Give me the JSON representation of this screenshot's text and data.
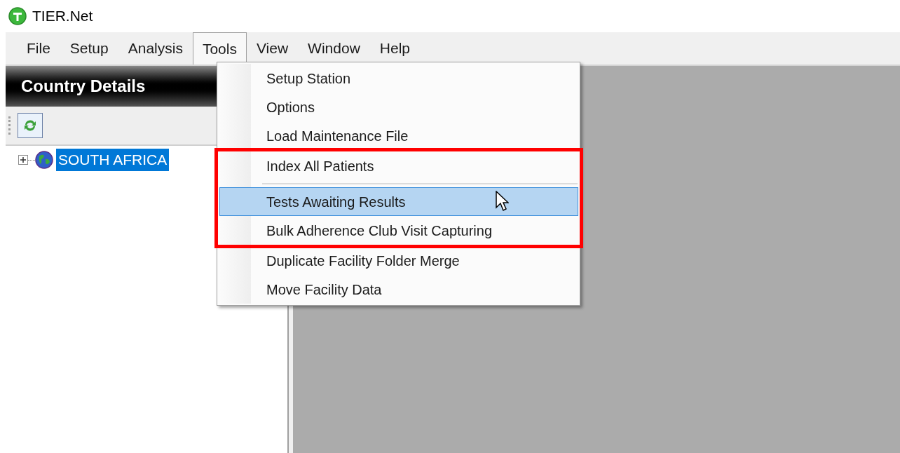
{
  "window": {
    "title": "TIER.Net"
  },
  "menu_bar": [
    {
      "label": "File",
      "open": false
    },
    {
      "label": "Setup",
      "open": false
    },
    {
      "label": "Analysis",
      "open": false
    },
    {
      "label": "Tools",
      "open": true
    },
    {
      "label": "View",
      "open": false
    },
    {
      "label": "Window",
      "open": false
    },
    {
      "label": "Help",
      "open": false
    }
  ],
  "dropdown": {
    "items": [
      {
        "kind": "item",
        "label": "Setup Station",
        "selected": false
      },
      {
        "kind": "item",
        "label": "Options",
        "selected": false
      },
      {
        "kind": "item",
        "label": "Load Maintenance File",
        "selected": false
      },
      {
        "kind": "item",
        "label": "Index All Patients",
        "selected": false,
        "annotated": true
      },
      {
        "kind": "separator",
        "annotated": true
      },
      {
        "kind": "item",
        "label": "Tests Awaiting Results",
        "selected": true,
        "annotated": true
      },
      {
        "kind": "item",
        "label": "Bulk Adherence Club Visit Capturing",
        "selected": false,
        "annotated": true
      },
      {
        "kind": "item",
        "label": "Duplicate Facility Folder Merge",
        "selected": false
      },
      {
        "kind": "item",
        "label": "Move Facility Data",
        "selected": false
      }
    ]
  },
  "side_panel": {
    "title": "Country Details",
    "tree": [
      {
        "label": "SOUTH AFRICA",
        "expanded": false,
        "selected": true
      }
    ]
  }
}
